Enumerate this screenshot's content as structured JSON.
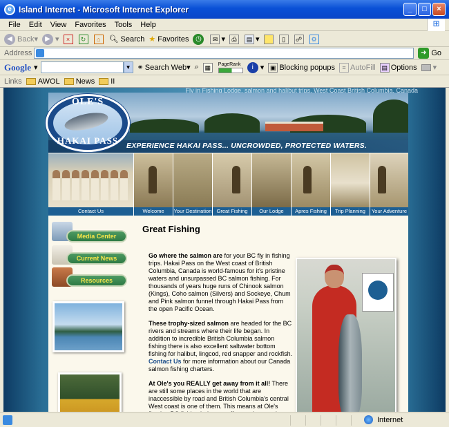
{
  "window": {
    "title": "Island Internet - Microsoft Internet Explorer",
    "minimize": "_",
    "maximize": "□",
    "close": "×"
  },
  "menu": [
    "File",
    "Edit",
    "View",
    "Favorites",
    "Tools",
    "Help"
  ],
  "toolbar": {
    "back": "Back",
    "search": "Search",
    "favorites": "Favorites"
  },
  "address": {
    "label": "Address",
    "value": "",
    "go": "Go"
  },
  "google": {
    "logo": "Google",
    "search_web": "Search Web",
    "pagerank": "PageRank",
    "blocking": "Blocking popups",
    "autofill": "AutoFill",
    "options": "Options"
  },
  "links": {
    "label": "Links",
    "items": [
      "AWOL",
      "News",
      "II"
    ]
  },
  "site": {
    "tagline": "Fly in Fishing Lodge, salmon and halibut trips, West Coast British Columbia, Canada",
    "logo_top": "OLE'S",
    "logo_bottom": "HAKAI PASS",
    "slogan": "EXPERIENCE HAKAI PASS...   UNCROWDED, PROTECTED WATERS.",
    "nav": [
      "Contact Us",
      "Welcome",
      "Your Destination",
      "Great Fishing",
      "Our Lodge",
      "Apres Fishing",
      "Trip Planning",
      "Your Adventure"
    ],
    "sidebar": [
      "Media Center",
      "Current News",
      "Resources"
    ],
    "page_title": "Great Fishing",
    "p1_bold": "Go where the salmon are",
    "p1": " for your BC fly in fishing trips. Hakai Pass on the West coast of British Columbia, Canada is world-famous for it's pristine waters and unsurpassed BC salmon fishing. For thousands of years huge runs of Chinook salmon (Kings), Coho salmon (Silvers) and Sockeye, Chum and Pink salmon funnel through Hakai Pass from the open Pacific Ocean.",
    "p2_bold": "These trophy-sized salmon",
    "p2": " are headed for the BC rivers and streams where their life began. In addition to incredible British Columbia salmon fishing there is also excellent saltwater bottom fishing for halibut, lingcod, red snapper and rockfish. ",
    "p2_link": "Contact Us",
    "p2_end": " for more information about our Canada salmon fishing charters.",
    "p3_bold": "At Ole's you REALLY get away from it all!",
    "p3": " There are still some places in the world that are inaccessible by road and British Columbia's central West coast is one of them. This means at Ole's floating BC fishing lodge we offer much more than \"just\" great British Columbia fishing trips. When you come salmon fishing at Ole's"
  },
  "status": {
    "zone": "Internet"
  }
}
